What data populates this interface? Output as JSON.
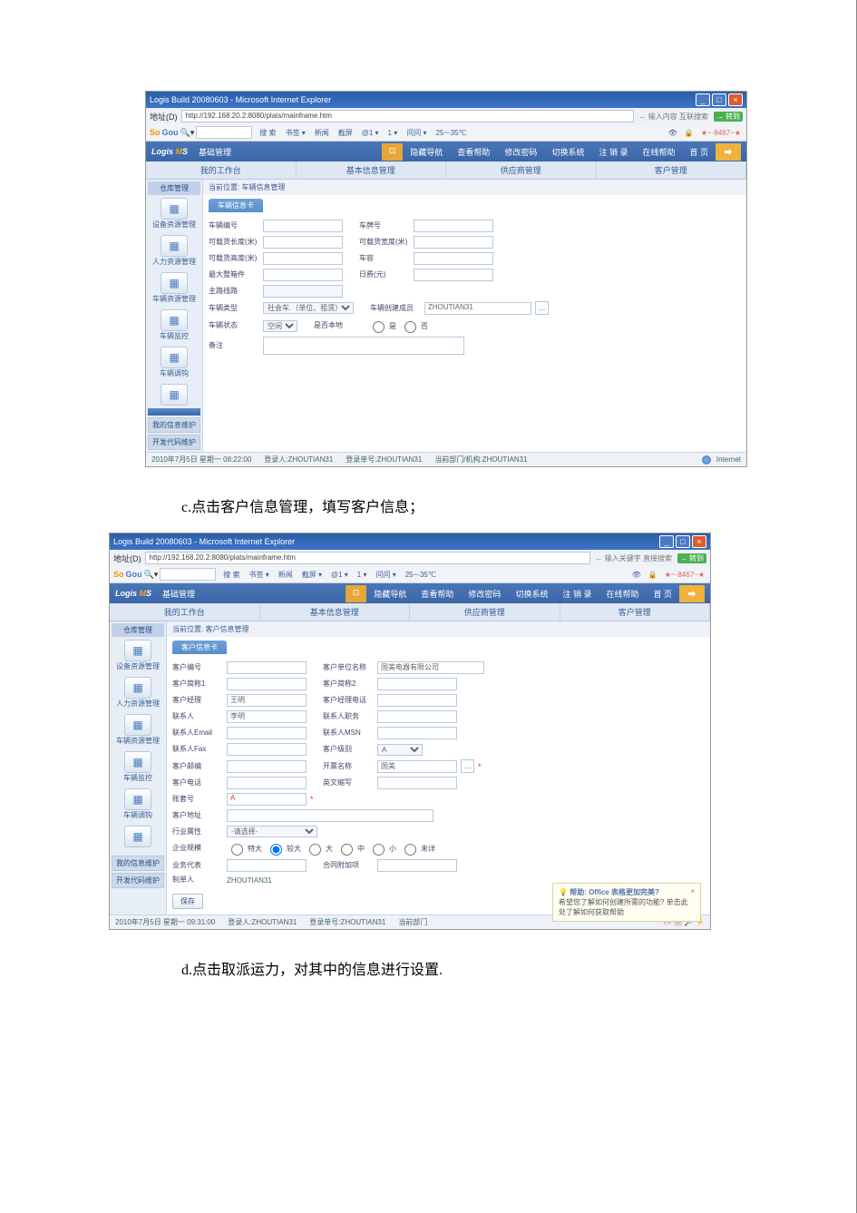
{
  "shot1": {
    "window_title": "Logis Build 20080603 - Microsoft Internet Explorer",
    "address_label": "地址(D)",
    "address_url": "http://192.168.20.2:8080/plats/mainframe.htm",
    "go_button": "转到",
    "search_hint": "输入内容 互联搜索",
    "toolbar": {
      "sogou": "So",
      "sogou2": "Gou",
      "items": [
        "搜 索",
        "书签 ▾",
        "新闻",
        "截屏",
        "@1 ▾",
        "1 ▾",
        "问问 ▾",
        "25~-35℃"
      ],
      "right": [
        "👁",
        "🔒",
        "★~·8467~★"
      ]
    },
    "app_title": "基础管理",
    "app_menu": [
      "隐藏导航",
      "查看帮助",
      "修改密码",
      "切换系统",
      "注 销 录",
      "在线帮助",
      "首  页"
    ],
    "submenu": [
      "我的工作台",
      "基本信息管理",
      "供应商管理",
      "客户管理"
    ],
    "sidebar_top": "仓库管理",
    "side_items": [
      "设备资源管理",
      "人力资源管理",
      "车辆资源管理",
      "车辆监控",
      "车辆调钩"
    ],
    "side_links": [
      "我的信息维护",
      "开发代码维护"
    ],
    "breadcrumb": "当前位置: 车辆信息管理",
    "tab": "车辆信息卡",
    "fields": {
      "vehicle_no": "车辆编号",
      "vehicle_no_val": "",
      "plate": "车牌号",
      "cert_len": "可载货长度(米)",
      "cert_width": "可载货宽度(米)",
      "cert_height": "可载货高度(米)",
      "box": "车容",
      "max_ok": "最大整箱件",
      "cost_rmb": "日费(元)",
      "route": "主路线路",
      "route_ph": "",
      "type": "车辆类型",
      "type_val": "社会车.（单位、租赁）",
      "made": "车辆创建成员",
      "made_val": "ZHOUTIAN31",
      "status": "车辆状态",
      "status_val": "空闲",
      "is_local": "是否本地",
      "is_yes": "是",
      "is_no": "否",
      "note": "备注"
    },
    "status": {
      "date": "2010年7月5日 星期一    08:22:00",
      "login": "登录人:ZHOUTIAN31",
      "loginno": "登录单号:ZHOUTIAN31",
      "dept": "当前部门/机构:ZHOUTIAN31",
      "net": "Internet"
    }
  },
  "shot2": {
    "window_title": "Logis Build 20080603 - Microsoft Internet Explorer",
    "address_label": "地址(D)",
    "address_url": "http://192.168.20.2:8080/plats/mainframe.htm",
    "go_button": "转到",
    "search_hint": "输入关键字 直接搜索",
    "toolbar": {
      "items": [
        "搜 索",
        "书签 ▾",
        "新闻",
        "截屏 ▾",
        "@1 ▾",
        "1 ▾",
        "问问 ▾",
        "25~-35℃"
      ],
      "right": [
        "👁",
        "🔒",
        "★~·8467~★"
      ]
    },
    "app_title": "基础管理",
    "app_menu": [
      "隐藏导航",
      "查看帮助",
      "修改密码",
      "切换系统",
      "注 销 录",
      "在线帮助",
      "首  页"
    ],
    "submenu": [
      "我的工作台",
      "基本信息管理",
      "供应商管理",
      "客户管理"
    ],
    "sidebar_top": "仓库管理",
    "side_items": [
      "设备资源管理",
      "人力资源管理",
      "车辆资源管理",
      "车辆监控",
      "车辆调钩"
    ],
    "side_links": [
      "我的信息维护",
      "开发代码维护"
    ],
    "breadcrumb": "当前位置: 客户信息管理",
    "tab": "客户信息卡",
    "fields": {
      "cust_no": "客户编号",
      "cust_name": "客户单位名称",
      "cust_name_val": "国美电器有限公司",
      "short1": "客户简称1",
      "short2": "客户简称2",
      "bank": "客户经理",
      "bank_val": "王明",
      "bank_tel": "客户经理电话",
      "contact": "联系人",
      "contact_val": "李明",
      "contact_pos": "联系人职务",
      "email": "联系人Email",
      "msn": "联系人MSN",
      "fax": "联系人Fax",
      "cust_level": "客户级别",
      "cust_level_val": "A",
      "cust_mail": "客户邮编",
      "pay_name": "开票名称",
      "pay_name_val": "国美",
      "cust_tel": "客户电话",
      "en_name": "英文缩写",
      "acct": "账套号",
      "acct_val": "A",
      "addr": "客户地址",
      "nature": "行业属性",
      "nature_ph": "-请选择-",
      "scale": "企业规模",
      "scale_opts": [
        "特大",
        "较大",
        "大",
        "中",
        "小",
        "未详"
      ],
      "agent": "业务代表",
      "contract": "合同附加项",
      "maker": "制单人",
      "maker_val": "ZHOUTIAN31"
    },
    "save": "保存",
    "status": {
      "date": "2010年7月5日 星期一    09:31:00",
      "login": "登录人:ZHOUTIAN31",
      "loginno": "登录单号:ZHOUTIAN31",
      "dept": "当前部门"
    },
    "assist_title": "帮助: Office 表格更加完美?",
    "assist_text": "希望您了解如何创建所需的功能? 单击此处了解如何获取帮助"
  },
  "caption_c": "c.点击客户信息管理，填写客户信息；",
  "caption_d": "d.点击取派运力，对其中的信息进行设置."
}
